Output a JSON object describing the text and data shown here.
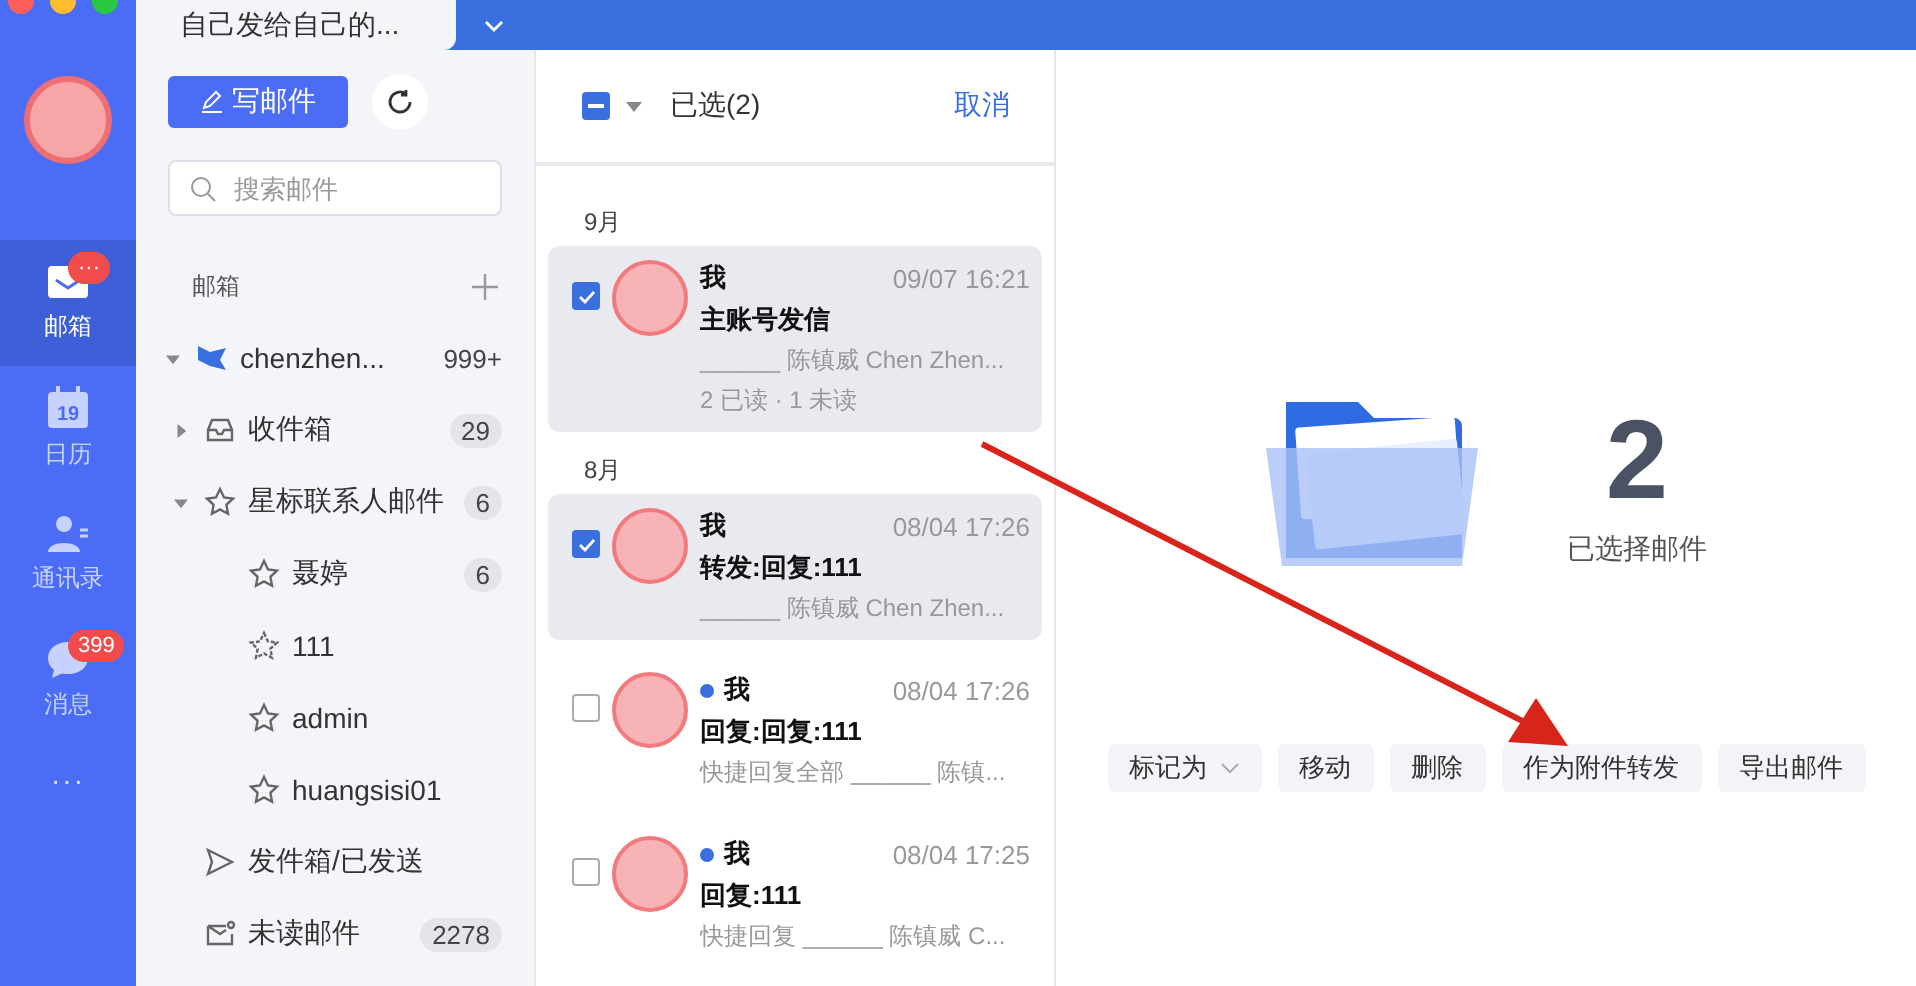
{
  "tabs": [
    {
      "label": "自己发给自己的...",
      "selected": true
    }
  ],
  "rail": {
    "items": [
      {
        "kind": "mail",
        "label": "邮箱",
        "selected": true,
        "badge": "···"
      },
      {
        "kind": "calendar",
        "label": "日历",
        "selected": false,
        "icon_text": "19"
      },
      {
        "kind": "contacts",
        "label": "通讯录",
        "selected": false
      },
      {
        "kind": "chat",
        "label": "消息",
        "selected": false,
        "badge": "399"
      }
    ],
    "more": "···"
  },
  "sidebar": {
    "compose_button": "写邮件",
    "search": {
      "placeholder": "搜索邮件"
    },
    "section": "邮箱",
    "account": {
      "name": "chenzhen...",
      "count": "999+",
      "expanded": true
    },
    "folders": [
      {
        "kind": "inbox",
        "label": "收件箱",
        "count": "29",
        "expanded": false
      },
      {
        "kind": "star",
        "label": "星标联系人邮件",
        "count": "6",
        "expanded": true,
        "children": [
          {
            "kind": "star",
            "label": "聂婷",
            "count": "6"
          },
          {
            "kind": "star-dashed",
            "label": "111"
          },
          {
            "kind": "star",
            "label": "admin"
          },
          {
            "kind": "star",
            "label": "huangsisi01"
          }
        ]
      },
      {
        "kind": "sent",
        "label": "发件箱/已发送"
      },
      {
        "kind": "unread",
        "label": "未读邮件",
        "count": "2278"
      }
    ]
  },
  "list": {
    "select_all": {
      "indeterminate": true
    },
    "selected_label": "已选(2)",
    "cancel": "取消",
    "groups": [
      {
        "month": "9月",
        "mails": [
          {
            "sender": "我",
            "time": "09/07 16:21",
            "subject": "主账号发信",
            "preview": "______ 陈镇威 Chen Zhen...",
            "status": "2 已读 · 1 未读",
            "unread": false,
            "selected": true
          }
        ]
      },
      {
        "month": "8月",
        "mails": [
          {
            "sender": "我",
            "time": "08/04 17:26",
            "subject": "转发:回复:111",
            "preview": "______ 陈镇威 Chen Zhen...",
            "unread": false,
            "selected": true
          },
          {
            "sender": "我",
            "time": "08/04 17:26",
            "subject": "回复:回复:111",
            "preview": "快捷回复全部 ______ 陈镇...",
            "unread": true,
            "selected": false
          },
          {
            "sender": "我",
            "time": "08/04 17:25",
            "subject": "回复:111",
            "preview": "快捷回复 ______ 陈镇威 C...",
            "unread": true,
            "selected": false
          }
        ]
      }
    ]
  },
  "detail": {
    "count": "2",
    "label": "已选择邮件",
    "actions": [
      {
        "label": "标记为",
        "dropdown": true
      },
      {
        "label": "移动",
        "dropdown": false
      },
      {
        "label": "删除",
        "dropdown": false
      },
      {
        "label": "作为附件转发",
        "dropdown": false
      },
      {
        "label": "导出邮件",
        "dropdown": false
      }
    ]
  }
}
